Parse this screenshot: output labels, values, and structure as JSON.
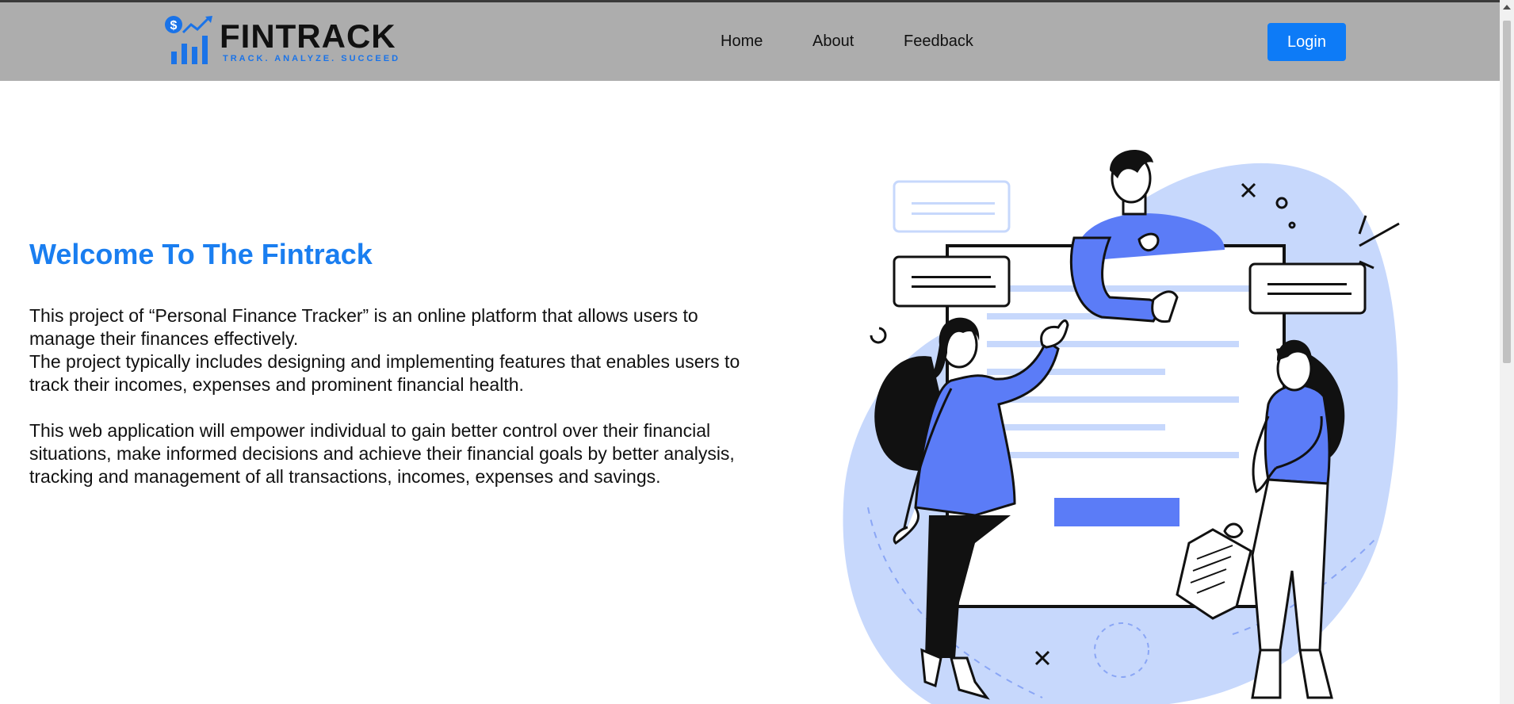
{
  "header": {
    "logo": {
      "wordmark": "FINTRACK",
      "tagline": "TRACK. ANALYZE. SUCCEED",
      "icon": "dollar-growth-chart-icon"
    },
    "nav": [
      {
        "label": "Home"
      },
      {
        "label": "About"
      },
      {
        "label": "Feedback"
      }
    ],
    "login_label": "Login"
  },
  "hero": {
    "title": "Welcome To The Fintrack",
    "paragraph1_line1": "This project of “Personal Finance Tracker” is an online platform that allows users to manage their finances effectively.",
    "paragraph1_line2": "The project typically includes designing and implementing features that enables users to track their incomes, expenses and prominent financial health.",
    "paragraph2": "This web application will empower individual to gain better control over their financial situations, make informed decisions and achieve their financial goals by better analysis, tracking and management of all transactions, incomes, expenses and savings."
  },
  "illustration": {
    "name": "team-collaboration-illustration"
  },
  "colors": {
    "navbar_bg": "#adadad",
    "accent": "#0d7bf7",
    "title": "#1a7ef0",
    "illustration_blue": "#5b7cf7",
    "illustration_light": "#c7d8fc"
  }
}
